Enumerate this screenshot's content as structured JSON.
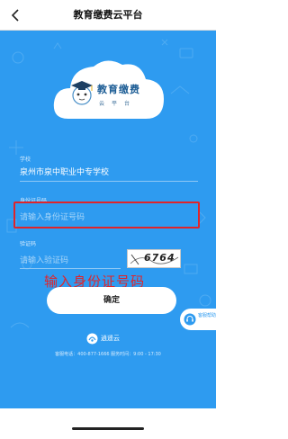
{
  "nav": {
    "title": "教育缴费云平台"
  },
  "logo": {
    "title": "教育缴费",
    "subtitle": "云平台"
  },
  "form": {
    "school": {
      "label": "学校",
      "value": "泉州市泉中职业中专学校"
    },
    "id_number": {
      "label": "身份证号码",
      "placeholder": "请输入身份证号码"
    },
    "captcha": {
      "label": "验证码",
      "placeholder": "请输入验证码",
      "image_text": "6764"
    }
  },
  "annotation": "输入身份证号码",
  "confirm_button": "确定",
  "help": {
    "label": "客服帮助"
  },
  "brand": "逍遥云",
  "footer": "客服电话：400-877-1666 服务时间：9:00 - 17:30",
  "colors": {
    "background": "#2e9bf0",
    "highlight": "#e0242a"
  },
  "icons": {
    "back": "chevron-left-icon",
    "help": "headset-icon",
    "brand": "brand-logo-icon"
  }
}
